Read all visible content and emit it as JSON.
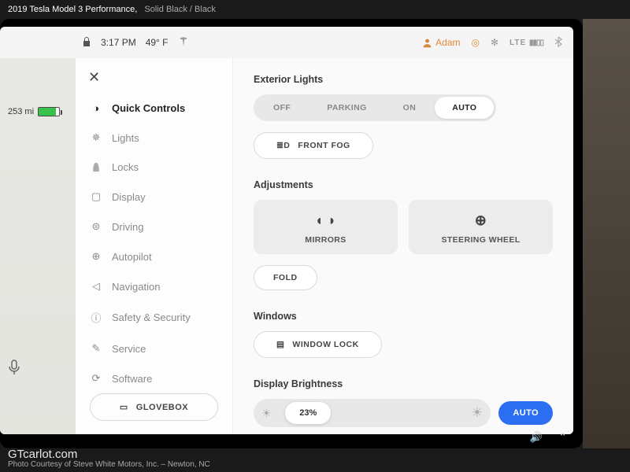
{
  "caption": {
    "model": "2019 Tesla Model 3 Performance,",
    "color": "Solid Black / Black",
    "watermark": "GTcarlot.com",
    "credit": "Photo Courtesy of Steve White Motors, Inc. – Newton, NC"
  },
  "statusbar": {
    "time": "3:17 PM",
    "temp": "49° F",
    "username": "Adam",
    "signal": "LTE"
  },
  "range": {
    "miles": "253 mi"
  },
  "sidebar": {
    "items": [
      {
        "label": "Quick Controls"
      },
      {
        "label": "Lights"
      },
      {
        "label": "Locks"
      },
      {
        "label": "Display"
      },
      {
        "label": "Driving"
      },
      {
        "label": "Autopilot"
      },
      {
        "label": "Navigation"
      },
      {
        "label": "Safety & Security"
      },
      {
        "label": "Service"
      },
      {
        "label": "Software"
      }
    ],
    "glovebox": "GLOVEBOX"
  },
  "content": {
    "exterior_lights": {
      "title": "Exterior Lights",
      "opts": [
        "OFF",
        "PARKING",
        "ON",
        "AUTO"
      ],
      "fog": "FRONT FOG"
    },
    "adjustments": {
      "title": "Adjustments",
      "mirrors": "MIRRORS",
      "steering": "STEERING WHEEL",
      "fold": "FOLD"
    },
    "windows": {
      "title": "Windows",
      "lock": "WINDOW LOCK"
    },
    "brightness": {
      "title": "Display Brightness",
      "value": "23%",
      "auto": "AUTO"
    }
  }
}
